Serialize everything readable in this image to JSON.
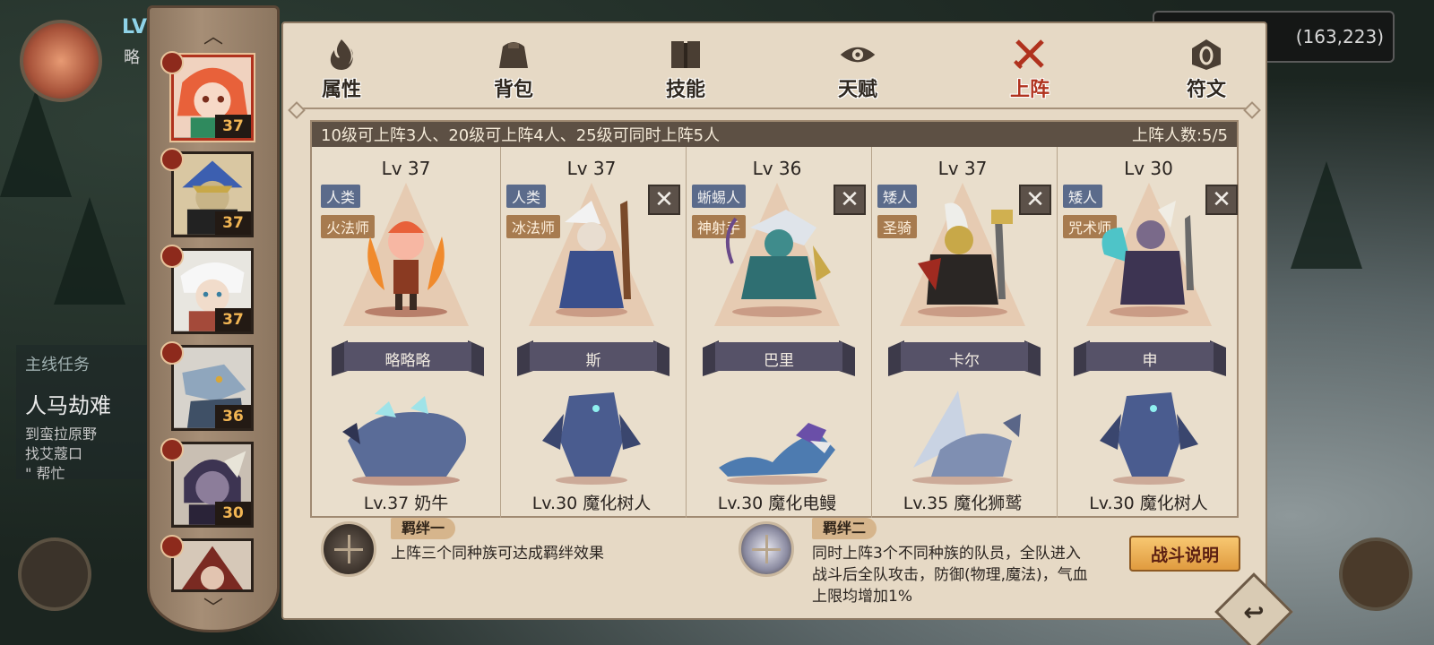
{
  "hud": {
    "level_prefix": "LV",
    "name_prefix": "略",
    "coordinates": "(163,223)"
  },
  "quest": {
    "title": "主线任务",
    "main": "人马劫难",
    "lines": [
      "到蛮拉原野",
      "找艾蔻口",
      "\" 帮忙"
    ]
  },
  "tabs": [
    {
      "label": "属性",
      "icon": "flame-icon"
    },
    {
      "label": "背包",
      "icon": "bag-icon"
    },
    {
      "label": "技能",
      "icon": "book-icon"
    },
    {
      "label": "天赋",
      "icon": "eye-emblem-icon"
    },
    {
      "label": "上阵",
      "icon": "crossed-swords-icon",
      "active": true
    },
    {
      "label": "符文",
      "icon": "rune-icon"
    }
  ],
  "hero_list": [
    {
      "level": "37",
      "badge": "flame"
    },
    {
      "level": "37",
      "badge": "flame"
    },
    {
      "level": "37",
      "badge": "flame"
    },
    {
      "level": "36",
      "badge": "flame"
    },
    {
      "level": "30",
      "badge": "flame"
    },
    {
      "level": "",
      "badge": "flame"
    }
  ],
  "lineup": {
    "requirement": "10级可上阵3人、20级可上阵4人、25级可同时上阵5人",
    "count_label": "上阵人数:5/5",
    "slots": [
      {
        "lv": "Lv 37",
        "race": "人类",
        "class": "火法师",
        "name": "略略略",
        "pet": "Lv.37 奶牛",
        "removable": false
      },
      {
        "lv": "Lv 37",
        "race": "人类",
        "class": "冰法师",
        "name": "斯",
        "pet": "Lv.30 魔化树人",
        "removable": true
      },
      {
        "lv": "Lv 36",
        "race": "蜥蜴人",
        "class": "神射手",
        "name": "巴里",
        "pet": "Lv.30 魔化电鳗",
        "removable": true
      },
      {
        "lv": "Lv 37",
        "race": "矮人",
        "class": "圣骑",
        "name": "卡尔",
        "pet": "Lv.35 魔化狮鹫",
        "removable": true
      },
      {
        "lv": "Lv 30",
        "race": "矮人",
        "class": "咒术师",
        "name": "申",
        "pet": "Lv.30 魔化树人",
        "removable": true
      }
    ]
  },
  "bonds": [
    {
      "tag": "羁绊一",
      "desc": "上阵三个同种族可达成羁绊效果"
    },
    {
      "tag": "羁绊二",
      "desc_lines": [
        "同时上阵3个不同种族的队员，全队进入",
        "战斗后全队攻击，防御(物理,魔法)，气血",
        "上限均增加1%"
      ]
    }
  ],
  "battle_info_label": "战斗说明",
  "colors": {
    "active_tab": "#b0321e",
    "level_text": "#f1b553",
    "race_tag": "#5b6b8b",
    "class_tag": "#a77b4f",
    "battle_button": "#e09b3f"
  }
}
